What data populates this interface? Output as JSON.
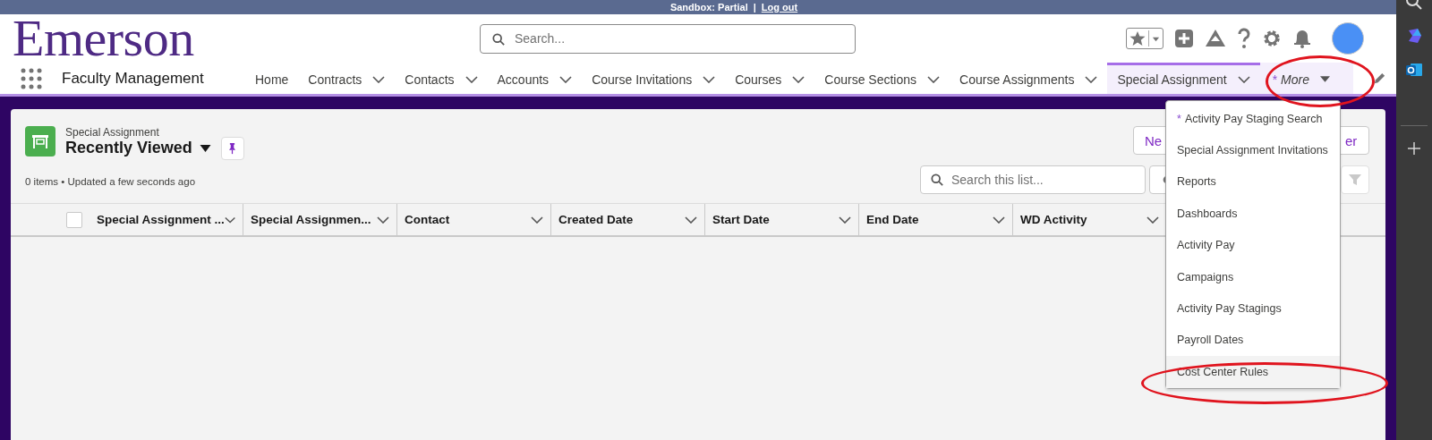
{
  "banner": {
    "sandbox": "Sandbox: Partial",
    "separator": "|",
    "link": "Log out"
  },
  "logo": "Emerson",
  "search": {
    "placeholder": "Search..."
  },
  "app_name": "Faculty Management",
  "nav": [
    {
      "label": "Home",
      "kind": "plain",
      "selected": false,
      "open": false
    },
    {
      "label": "Contracts",
      "kind": "dropdown",
      "selected": false,
      "open": false
    },
    {
      "label": "Contacts",
      "kind": "dropdown",
      "selected": false,
      "open": false
    },
    {
      "label": "Accounts",
      "kind": "dropdown",
      "selected": false,
      "open": false
    },
    {
      "label": "Course Invitations",
      "kind": "dropdown",
      "selected": false,
      "open": false
    },
    {
      "label": "Courses",
      "kind": "dropdown",
      "selected": false,
      "open": false
    },
    {
      "label": "Course Sections",
      "kind": "dropdown",
      "selected": false,
      "open": false
    },
    {
      "label": "Course Assignments",
      "kind": "dropdown",
      "selected": false,
      "open": false
    },
    {
      "label": "Special Assignment",
      "kind": "dropdown",
      "selected": true,
      "open": false
    },
    {
      "label": "More",
      "mark": "*",
      "kind": "more",
      "selected": false,
      "open": true,
      "highlighted": true
    }
  ],
  "more_menu": [
    {
      "label": "Activity Pay Staging Search",
      "mark": "*",
      "hovered": false,
      "highlighted": false
    },
    {
      "label": "Special Assignment Invitations",
      "hovered": false,
      "highlighted": false
    },
    {
      "label": "Reports",
      "hovered": false,
      "highlighted": false
    },
    {
      "label": "Dashboards",
      "hovered": false,
      "highlighted": false
    },
    {
      "label": "Activity Pay",
      "hovered": false,
      "highlighted": false
    },
    {
      "label": "Campaigns",
      "hovered": false,
      "highlighted": false
    },
    {
      "label": "Activity Pay Stagings",
      "hovered": false,
      "highlighted": false
    },
    {
      "label": "Payroll Dates",
      "hovered": false,
      "highlighted": false
    },
    {
      "label": "Cost Center Rules",
      "hovered": true,
      "highlighted": true
    }
  ],
  "list_view": {
    "object": "Special Assignment",
    "title": "Recently Viewed",
    "status": "0 items • Updated a few seconds ago",
    "search_placeholder": "Search this list...",
    "buttons": [
      "Ne",
      "er"
    ]
  },
  "select_all": {
    "checked": false
  },
  "columns": [
    "Special Assignment ...",
    "Special Assignmen...",
    "Contact",
    "Created Date",
    "Start Date",
    "End Date",
    "WD Activity"
  ]
}
